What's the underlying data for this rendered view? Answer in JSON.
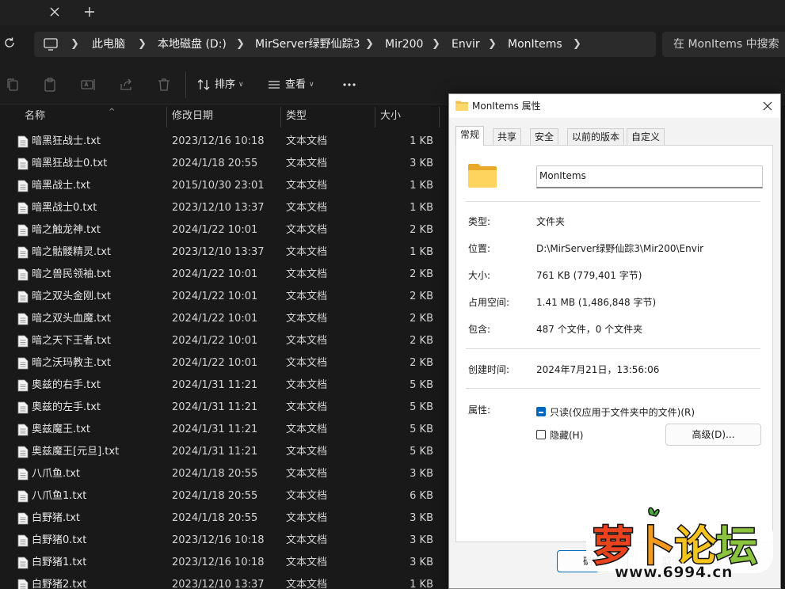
{
  "tabstrip": {
    "close_label": "✕",
    "new_label": "+"
  },
  "breadcrumb": {
    "items": [
      "此电脑",
      "本地磁盘 (D:)",
      "MirServer绿野仙踪3",
      "Mir200",
      "Envir",
      "MonItems"
    ]
  },
  "search": {
    "placeholder": "在 MonItems 中搜索"
  },
  "toolbar": {
    "sort_label": "排序",
    "view_label": "查看"
  },
  "columns": {
    "name": "名称",
    "date": "修改日期",
    "type": "类型",
    "size": "大小"
  },
  "files": [
    {
      "name": "暗黑狂战士.txt",
      "date": "2023/12/16 10:18",
      "type": "文本文档",
      "size": "1 KB"
    },
    {
      "name": "暗黑狂战士0.txt",
      "date": "2024/1/18 20:55",
      "type": "文本文档",
      "size": "3 KB"
    },
    {
      "name": "暗黑战士.txt",
      "date": "2015/10/30 23:01",
      "type": "文本文档",
      "size": "1 KB"
    },
    {
      "name": "暗黑战士0.txt",
      "date": "2023/12/10 13:37",
      "type": "文本文档",
      "size": "1 KB"
    },
    {
      "name": "暗之触龙神.txt",
      "date": "2024/1/22 10:01",
      "type": "文本文档",
      "size": "2 KB"
    },
    {
      "name": "暗之骷髅精灵.txt",
      "date": "2023/12/10 13:37",
      "type": "文本文档",
      "size": "1 KB"
    },
    {
      "name": "暗之兽民领袖.txt",
      "date": "2024/1/22 10:01",
      "type": "文本文档",
      "size": "2 KB"
    },
    {
      "name": "暗之双头金刚.txt",
      "date": "2024/1/22 10:01",
      "type": "文本文档",
      "size": "2 KB"
    },
    {
      "name": "暗之双头血魔.txt",
      "date": "2024/1/22 10:01",
      "type": "文本文档",
      "size": "2 KB"
    },
    {
      "name": "暗之天下王者.txt",
      "date": "2024/1/22 10:01",
      "type": "文本文档",
      "size": "2 KB"
    },
    {
      "name": "暗之沃玛教主.txt",
      "date": "2024/1/22 10:01",
      "type": "文本文档",
      "size": "2 KB"
    },
    {
      "name": "奥兹的右手.txt",
      "date": "2024/1/31 11:21",
      "type": "文本文档",
      "size": "5 KB"
    },
    {
      "name": "奥兹的左手.txt",
      "date": "2024/1/31 11:21",
      "type": "文本文档",
      "size": "5 KB"
    },
    {
      "name": "奥兹魔王.txt",
      "date": "2024/1/31 11:21",
      "type": "文本文档",
      "size": "5 KB"
    },
    {
      "name": "奥兹魔王[元旦].txt",
      "date": "2024/1/31 11:21",
      "type": "文本文档",
      "size": "5 KB"
    },
    {
      "name": "八爪鱼.txt",
      "date": "2024/1/18 20:55",
      "type": "文本文档",
      "size": "3 KB"
    },
    {
      "name": "八爪鱼1.txt",
      "date": "2024/1/18 20:55",
      "type": "文本文档",
      "size": "6 KB"
    },
    {
      "name": "白野猪.txt",
      "date": "2024/1/18 20:55",
      "type": "文本文档",
      "size": "3 KB"
    },
    {
      "name": "白野猪0.txt",
      "date": "2023/12/16 10:18",
      "type": "文本文档",
      "size": "3 KB"
    },
    {
      "name": "白野猪1.txt",
      "date": "2023/12/16 10:18",
      "type": "文本文档",
      "size": "3 KB"
    },
    {
      "name": "白野猪2.txt",
      "date": "2023/12/10 13:37",
      "type": "文本文档",
      "size": "1 KB"
    }
  ],
  "dialog": {
    "title": "MonItems 属性",
    "tabs": [
      "常规",
      "共享",
      "安全",
      "以前的版本",
      "自定义"
    ],
    "folder_name": "MonItems",
    "type_label": "类型:",
    "type_value": "文件夹",
    "location_label": "位置:",
    "location_value": "D:\\MirServer绿野仙踪3\\Mir200\\Envir",
    "size_label": "大小:",
    "size_value": "761 KB (779,401 字节)",
    "disk_label": "占用空间:",
    "disk_value": "1.41 MB (1,486,848 字节)",
    "contains_label": "包含:",
    "contains_value": "487 个文件，0 个文件夹",
    "created_label": "创建时间:",
    "created_value": "2024年7月21日，13:56:06",
    "attrs_label": "属性:",
    "readonly_label": "只读(仅应用于文件夹中的文件)(R)",
    "hidden_label": "隐藏(H)",
    "advanced_label": "高级(D)...",
    "ok_label": "确定",
    "cancel_label": "取消"
  },
  "watermark": {
    "logo_text": "萝卜论坛",
    "site": "www.6994.cn"
  }
}
